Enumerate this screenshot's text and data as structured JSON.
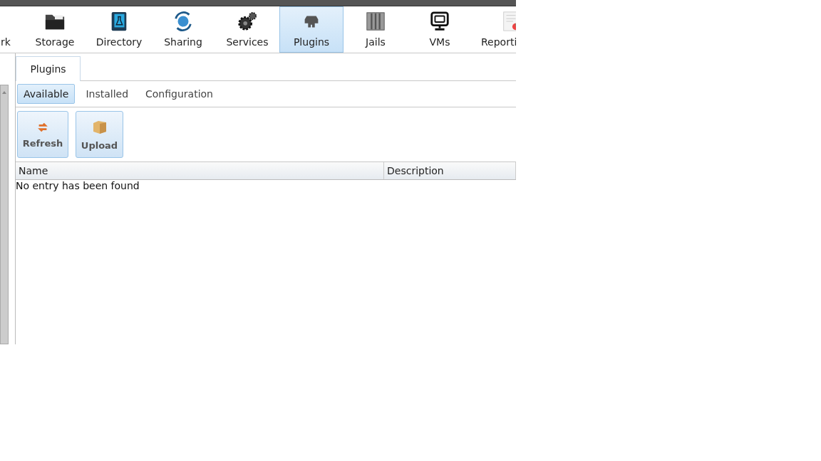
{
  "toolbar": {
    "items": [
      {
        "label": "rk",
        "kind": "none",
        "selected": false
      },
      {
        "label": "Storage",
        "kind": "folder",
        "selected": false
      },
      {
        "label": "Directory",
        "kind": "book",
        "selected": false
      },
      {
        "label": "Sharing",
        "kind": "globe",
        "selected": false
      },
      {
        "label": "Services",
        "kind": "gears",
        "selected": false
      },
      {
        "label": "Plugins",
        "kind": "plug",
        "selected": true
      },
      {
        "label": "Jails",
        "kind": "bars",
        "selected": false
      },
      {
        "label": "VMs",
        "kind": "monitor",
        "selected": false
      },
      {
        "label": "Reporti",
        "kind": "report",
        "selected": false
      }
    ]
  },
  "tab": {
    "label": "Plugins"
  },
  "subtabs": [
    {
      "label": "Available",
      "selected": true
    },
    {
      "label": "Installed",
      "selected": false
    },
    {
      "label": "Configuration",
      "selected": false
    }
  ],
  "actions": [
    {
      "label": "Refresh",
      "kind": "refresh"
    },
    {
      "label": "Upload",
      "kind": "box"
    }
  ],
  "table": {
    "columns": [
      "Name",
      "Description"
    ],
    "empty_text": "No entry has been found"
  }
}
